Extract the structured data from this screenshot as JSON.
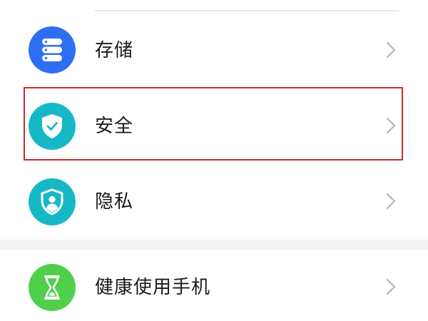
{
  "colors": {
    "storage_icon_bg": "#2f6ef3",
    "security_icon_bg": "#17b8c6",
    "privacy_icon_bg": "#17b8c6",
    "health_icon_bg": "#4fcf4a",
    "highlight_border": "#d3292b",
    "chevron": "#b3b3b3",
    "text": "#1a1a1a"
  },
  "settings": {
    "items": [
      {
        "label": "存储",
        "icon": "storage-icon"
      },
      {
        "label": "安全",
        "icon": "shield-check-icon",
        "highlighted": true
      },
      {
        "label": "隐私",
        "icon": "privacy-shield-user-icon"
      },
      {
        "label": "健康使用手机",
        "icon": "hourglass-icon"
      }
    ]
  }
}
